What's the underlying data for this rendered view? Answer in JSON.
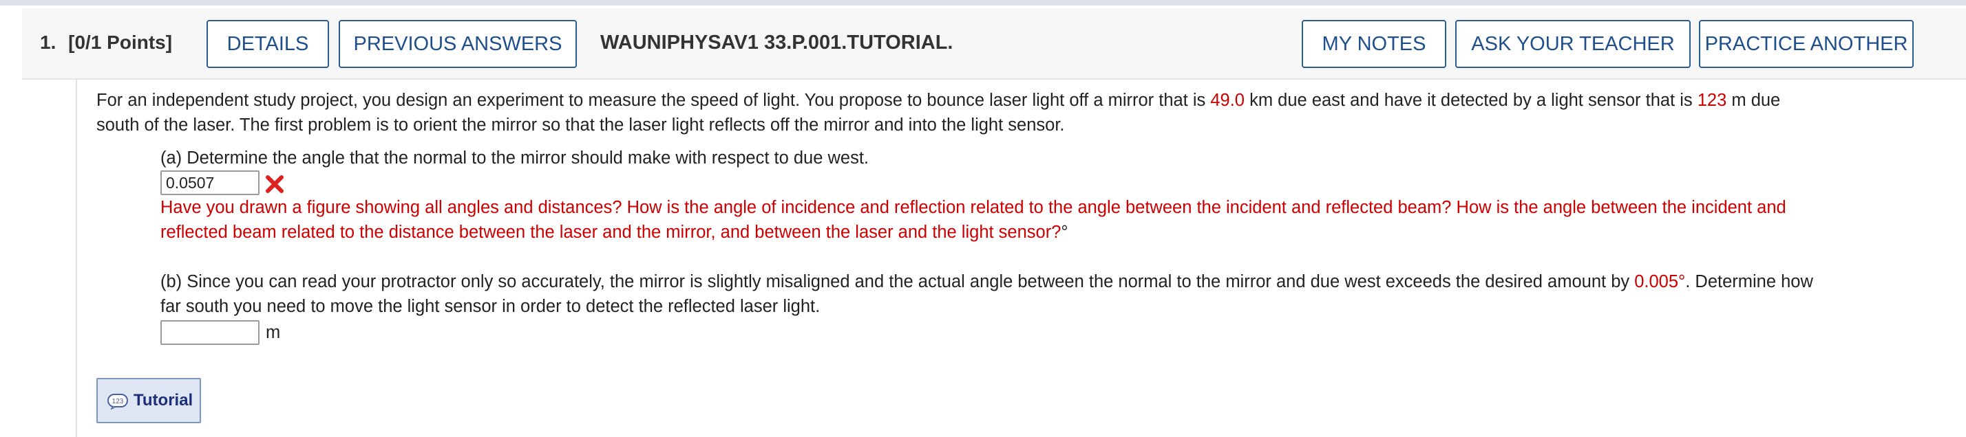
{
  "header": {
    "question_number": "1.",
    "points": "[0/1 Points]",
    "details_label": "DETAILS",
    "previous_answers_label": "PREVIOUS ANSWERS",
    "assignment_code": "WAUNIPHYSAV1 33.P.001.TUTORIAL.",
    "my_notes_label": "MY NOTES",
    "ask_teacher_label": "ASK YOUR TEACHER",
    "practice_another_label": "PRACTICE ANOTHER"
  },
  "problem": {
    "intro_1": "For an independent study project, you design an experiment to measure the speed of light. You propose to bounce laser light off a mirror that is ",
    "mirror_distance": "49.0",
    "intro_2": " km due east and have it detected by a light sensor that is ",
    "sensor_distance": "123",
    "intro_3": " m due",
    "intro_line2": "south of the laser. The first problem is to orient the mirror so that the laser light reflects off the mirror and into the light sensor."
  },
  "part_a": {
    "question": "(a) Determine the angle that the normal to the mirror should make with respect to due west.",
    "answer_value": "0.0507",
    "status_icon": "incorrect-x-icon",
    "feedback_line1": "Have you drawn a figure showing all angles and distances? How is the angle of incidence and reflection related to the angle between the incident and reflected beam? How is the angle between the incident and",
    "feedback_line2": "reflected beam related to the distance between the laser and the mirror, and between the laser and the light sensor?",
    "unit": "°"
  },
  "part_b": {
    "question_1": "(b) Since you can read your protractor only so accurately, the mirror is slightly misaligned and the actual angle between the normal to the mirror and due west exceeds the desired amount by ",
    "excess_angle": "0.005°",
    "question_2": ". Determine how",
    "question_line2": "far south you need to move the light sensor in order to detect the reflected laser light.",
    "answer_value": "",
    "unit": "m"
  },
  "tutorial": {
    "icon": "calculator-123-icon",
    "label": "Tutorial"
  },
  "colors": {
    "accent": "#1e4f8c",
    "error": "#cc0000",
    "header_bg": "#f6f6f6"
  }
}
